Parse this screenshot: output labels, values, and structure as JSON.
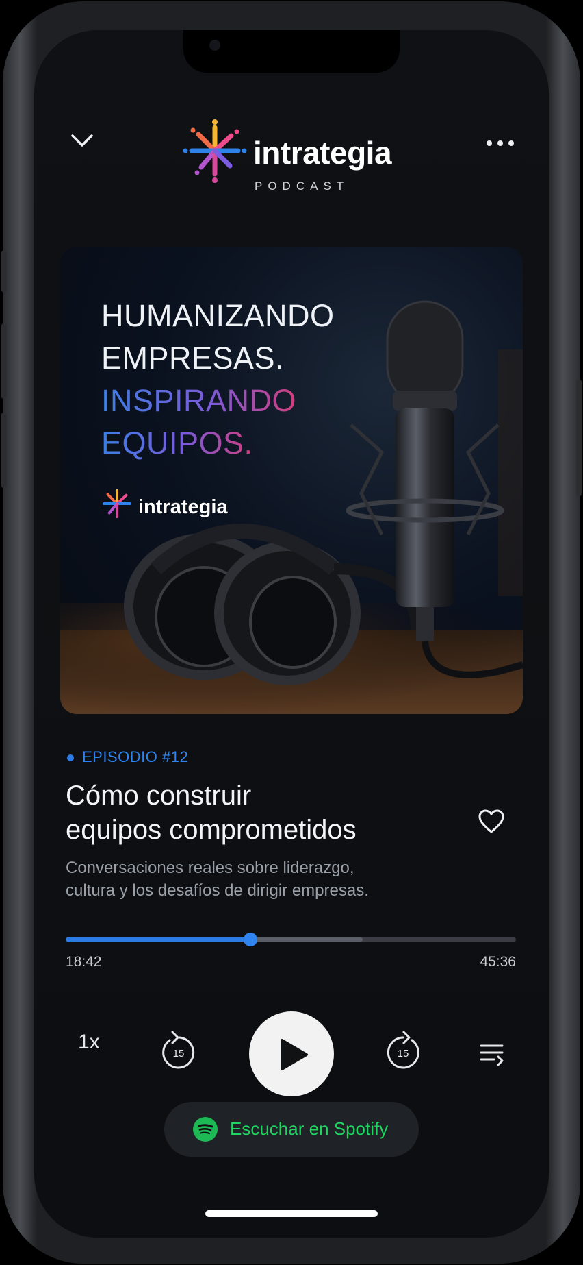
{
  "header": {
    "brand": "intrategia",
    "subtitle": "PODCAST"
  },
  "cover": {
    "line1": "HUMANIZANDO",
    "line2": "EMPRESAS.",
    "line3": "INSPIRANDO",
    "line4": "EQUIPOS.",
    "brand": "intrategia"
  },
  "episode": {
    "label": "EPISODIO #12",
    "title_line1": "Cómo construir",
    "title_line2": "equipos comprometidos",
    "description_line1": "Conversaciones reales sobre liderazgo,",
    "description_line2": "cultura y los desafíos de dirigir empresas."
  },
  "player": {
    "current_time": "18:42",
    "total_time": "45:36",
    "progress": 0.41,
    "buffered": 0.66,
    "speed": "1x",
    "rewind_seconds": "15",
    "forward_seconds": "15"
  },
  "spotify": {
    "label": "Escuchar en Spotify"
  },
  "colors": {
    "accent": "#2c7be5",
    "spotify_green": "#1ed760",
    "background": "#0f1114"
  }
}
